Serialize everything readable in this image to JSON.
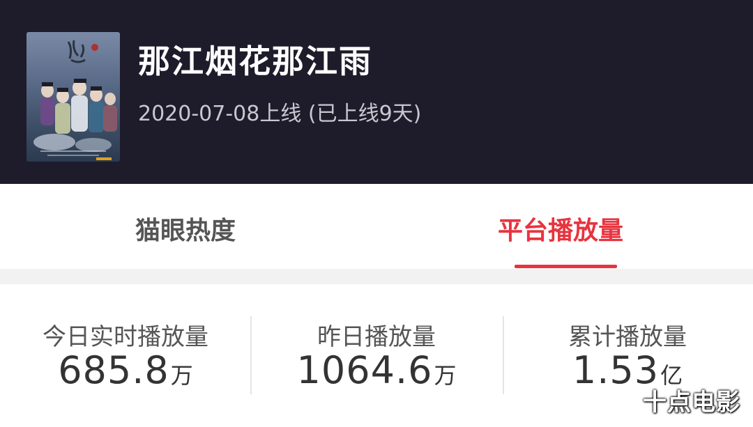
{
  "header": {
    "title": "那江烟花那江雨",
    "subtitle": "2020-07-08上线 (已上线9天)"
  },
  "tabs": [
    {
      "label": "猫眼热度",
      "active": false
    },
    {
      "label": "平台播放量",
      "active": true
    }
  ],
  "stats": [
    {
      "label": "今日实时播放量",
      "value": "685.8",
      "unit": "万"
    },
    {
      "label": "昨日播放量",
      "value": "1064.6",
      "unit": "万"
    },
    {
      "label": "累计播放量",
      "value": "1.53",
      "unit": "亿"
    }
  ],
  "watermark": "十点电影",
  "colors": {
    "header_bg": "#1e1c2b",
    "accent": "#e8343f",
    "text_dark": "#333333",
    "text_muted": "#555555"
  }
}
